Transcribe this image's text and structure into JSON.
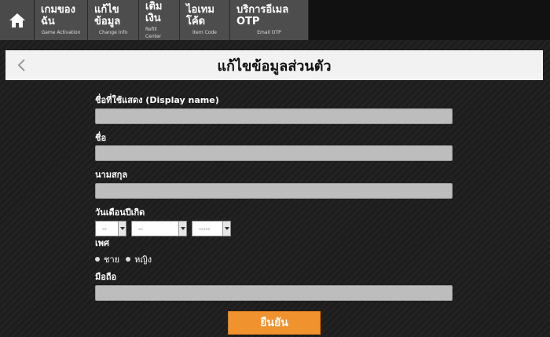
{
  "nav": {
    "home_icon": "home-icon",
    "items": [
      {
        "th": "เกมของฉัน",
        "en": "Game Activation"
      },
      {
        "th": "แก้ไขข้อมูล",
        "en": "Change Info"
      },
      {
        "th": "เติมเงิน",
        "en": "Refill Center"
      },
      {
        "th": "ไอเทมโค้ด",
        "en": "Item Code"
      },
      {
        "th": "บริการอีเมล OTP",
        "en": "Email OTP"
      }
    ]
  },
  "page": {
    "title": "แก้ไขข้อมูลส่วนตัว",
    "back_icon": "chevron-left-icon"
  },
  "form": {
    "display_name_label": "ชื่อที่ใช้แสดง (Display name)",
    "display_name_value": "",
    "first_name_label": "ชื่อ",
    "first_name_value": "",
    "last_name_label": "นามสกุล",
    "last_name_value": "",
    "birthdate_label": "วันเดือนปีเกิด",
    "day_value": "--",
    "month_value": "--",
    "year_value": "-----",
    "gender_label": "เพศ",
    "gender_male": "ชาย",
    "gender_female": "หญิง",
    "mobile_label": "มือถือ",
    "mobile_value": "",
    "submit_label": "ยืนยัน"
  },
  "colors": {
    "accent": "#f0922e",
    "nav_bg": "#4d4d4d",
    "field_bg": "#bdbdbd"
  }
}
